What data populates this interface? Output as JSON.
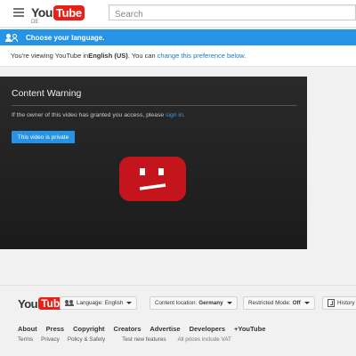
{
  "header": {
    "logo_you": "You",
    "logo_tube": "Tube",
    "country": "DE",
    "search_placeholder": "Search"
  },
  "language_banner": {
    "title": "Choose your language.",
    "pref_prefix": "You're viewing YouTube in ",
    "pref_language": "English (US)",
    "pref_middle": ". You can ",
    "pref_link": "change this preference below."
  },
  "player": {
    "title": "Content Warning",
    "message_prefix": "If the owner of this video has granted you access, please ",
    "message_link": "sign in",
    "message_suffix": ".",
    "private_button": "This video is private",
    "sad_icon": "sad-youtube-icon",
    "sad_icon_color": "#c4151c"
  },
  "footer": {
    "logo_you": "You",
    "logo_tube": "Tube",
    "language_label": "Language:",
    "language_value": "English",
    "location_label": "Content location:",
    "location_value": "Germany",
    "restricted_label": "Restricted Mode:",
    "restricted_value": "Off",
    "history_label": "History",
    "links": [
      "About",
      "Press",
      "Copyright",
      "Creators",
      "Advertise",
      "Developers",
      "+YouTube"
    ],
    "sub_links": [
      "Terms",
      "Privacy",
      "Policy & Safety",
      "Test new features"
    ],
    "vat_note": "All prices include VAT"
  },
  "colors": {
    "accent_blue": "#2793e6",
    "link_blue": "#167ac6",
    "youtube_red": "#e62117"
  }
}
